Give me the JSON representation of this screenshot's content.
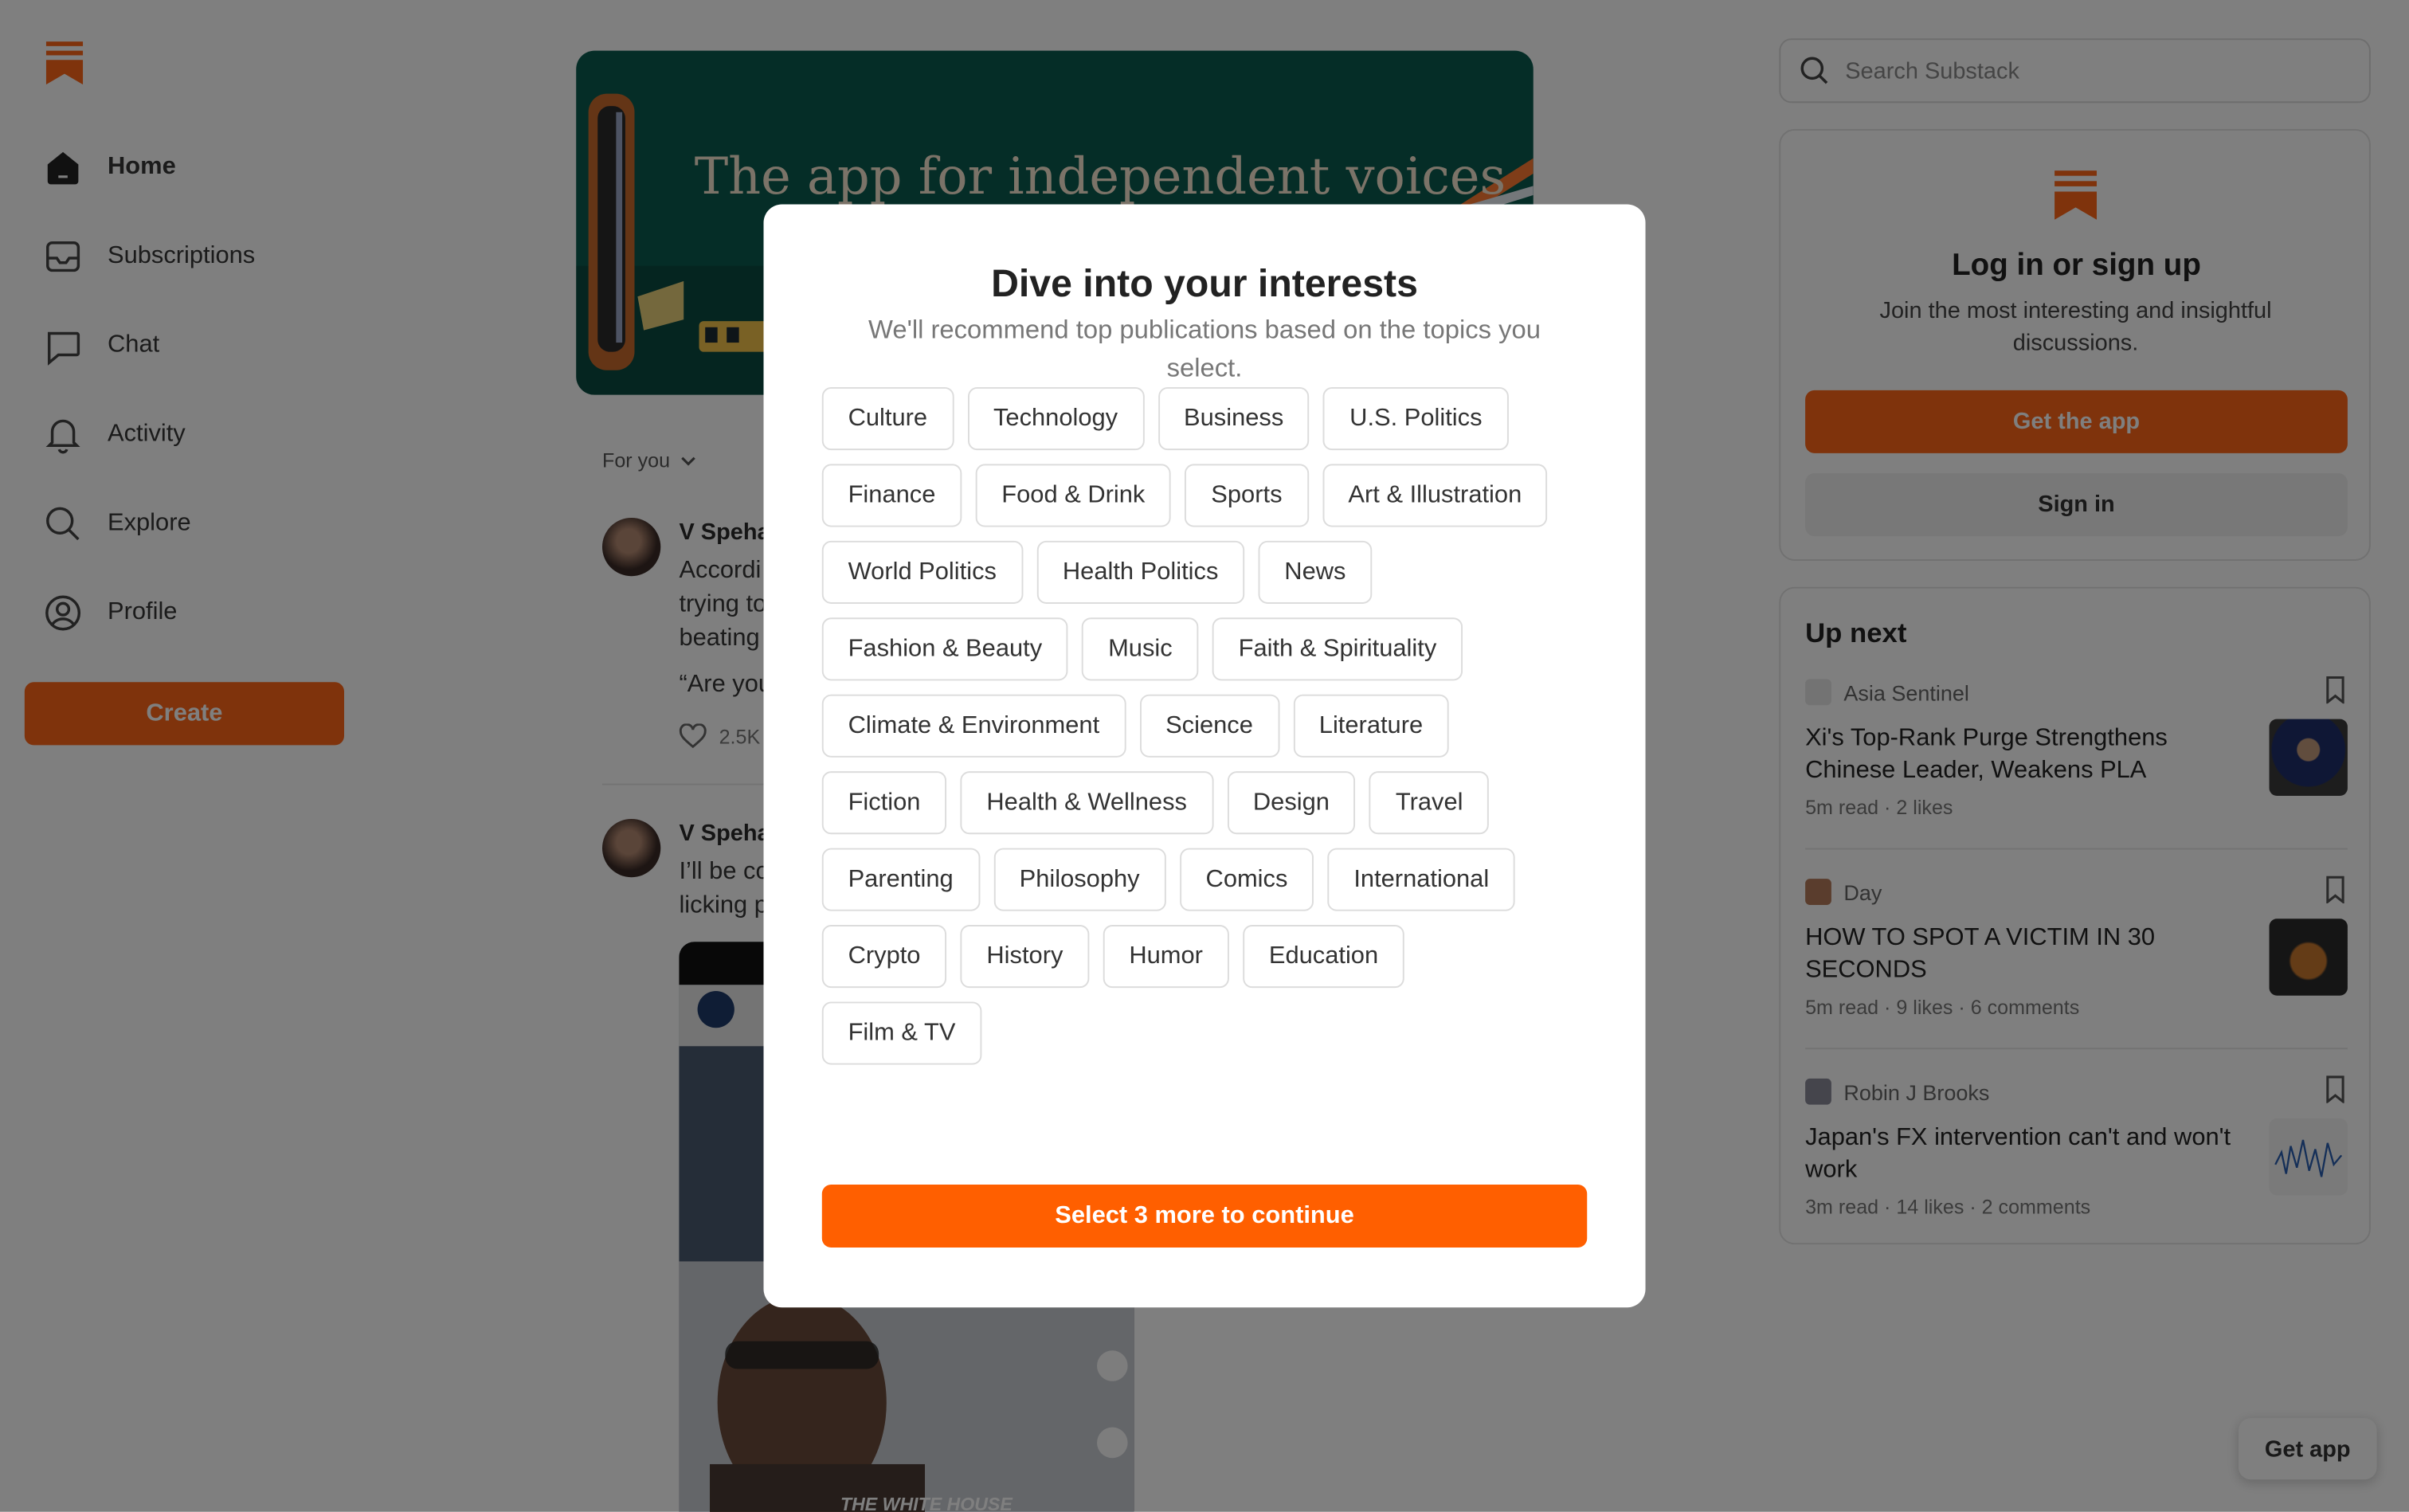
{
  "nav": {
    "items": [
      {
        "label": "Home",
        "icon": "home-icon"
      },
      {
        "label": "Subscriptions",
        "icon": "inbox-icon"
      },
      {
        "label": "Chat",
        "icon": "chat-icon"
      },
      {
        "label": "Activity",
        "icon": "bell-icon"
      },
      {
        "label": "Explore",
        "icon": "search-icon"
      },
      {
        "label": "Profile",
        "icon": "profile-icon"
      }
    ],
    "create_label": "Create"
  },
  "banner": {
    "title": "The app for independent voices"
  },
  "feed": {
    "filter_label": "For you",
    "posts": [
      {
        "author": "V Speha",
        "body_lines": [
          "Accordi",
          "trying to",
          "beating"
        ],
        "quote": "“Are you",
        "likes": "2.5K"
      },
      {
        "author": "V Speha",
        "body_lines": [
          "I’ll be co",
          "licking p"
        ]
      }
    ],
    "video_caption": "THE WHITE HOUSE"
  },
  "search": {
    "placeholder": "Search Substack"
  },
  "login": {
    "title": "Log in or sign up",
    "subtitle": "Join the most interesting and insightful discussions.",
    "get_app_label": "Get the app",
    "sign_in_label": "Sign in"
  },
  "up_next": {
    "title": "Up next",
    "items": [
      {
        "publication": "Asia Sentinel",
        "headline": "Xi's Top-Rank Purge Strengthens Chinese Leader, Weakens PLA",
        "meta": "5m read · 2 likes"
      },
      {
        "publication": "Day",
        "headline": "HOW TO SPOT A VICTIM IN 30 SECONDS",
        "meta": "5m read · 9 likes · 6 comments"
      },
      {
        "publication": "Robin J Brooks",
        "headline": "Japan's FX intervention can't and won't work",
        "meta": "3m read · 14 likes · 2 comments"
      }
    ]
  },
  "float_button": "Get app",
  "modal": {
    "title": "Dive into your interests",
    "subtitle": "We'll recommend top publications based on the topics you select.",
    "chip_rows": [
      [
        "Culture",
        "Technology",
        "Business",
        "U.S. Politics"
      ],
      [
        "Finance",
        "Food & Drink",
        "Sports",
        "Art & Illustration"
      ],
      [
        "World Politics",
        "Health Politics",
        "News"
      ],
      [
        "Fashion & Beauty",
        "Music",
        "Faith & Spirituality"
      ],
      [
        "Climate & Environment",
        "Science",
        "Literature"
      ],
      [
        "Fiction",
        "Health & Wellness",
        "Design",
        "Travel"
      ],
      [
        "Parenting",
        "Philosophy",
        "Comics",
        "International"
      ],
      [
        "Crypto",
        "History",
        "Humor",
        "Education"
      ],
      [
        "Film & TV"
      ]
    ],
    "continue_label": "Select 3 more to continue"
  },
  "colors": {
    "brand": "#ff6719",
    "modal_button": "#ff5f00",
    "banner_bg": "#0b5a4e"
  }
}
